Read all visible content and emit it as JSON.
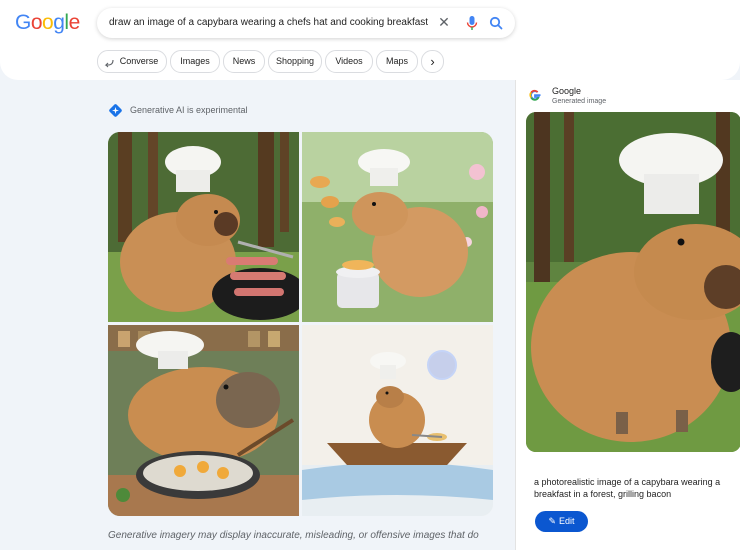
{
  "header": {
    "logo_text": "Google",
    "search_query": "draw an image of a capybara wearing a chefs hat and cooking breakfast",
    "clear_icon": "close-icon",
    "mic_icon": "mic-icon",
    "search_icon": "search-icon"
  },
  "chips": [
    {
      "label": "Converse",
      "icon": "converse-icon"
    },
    {
      "label": "Images"
    },
    {
      "label": "News"
    },
    {
      "label": "Shopping"
    },
    {
      "label": "Videos"
    },
    {
      "label": "Maps"
    },
    {
      "label": "›"
    }
  ],
  "ai": {
    "label": "Generative AI is experimental",
    "disclaimer": "Generative imagery may display inaccurate, misleading, or offensive images that do"
  },
  "panel": {
    "source": "Google",
    "subtitle": "Generated image",
    "caption_line1": "a photorealistic image of a capybara wearing a",
    "caption_line2": "breakfast in a forest, grilling bacon",
    "edit_label": "Edit"
  },
  "colors": {
    "accent": "#0b57d0",
    "page_bg": "#f0f4f9",
    "capybara": "#c98f55"
  }
}
